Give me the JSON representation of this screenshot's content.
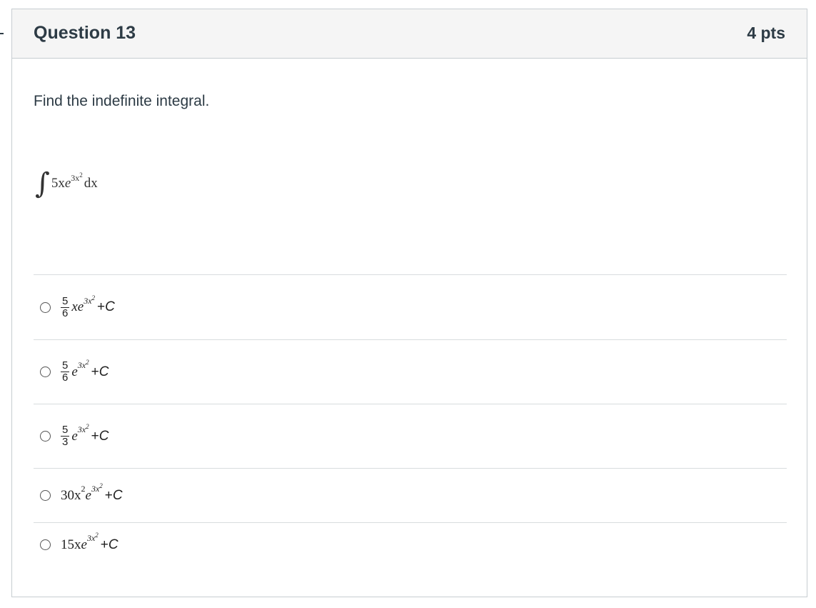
{
  "question": {
    "title": "Question 13",
    "points": "4 pts",
    "prompt": "Find the indefinite integral.",
    "integral": {
      "sign": "∫",
      "coefficient": "5x",
      "base": "e",
      "exponent": "3x",
      "exponent_power": "2",
      "differential": "dx"
    }
  },
  "answers": [
    {
      "frac_num": "5",
      "frac_den": "6",
      "lead": "",
      "term": "xe",
      "exponent": "3x",
      "exponent_power": "2",
      "plus": "+",
      "constant": "C"
    },
    {
      "frac_num": "5",
      "frac_den": "6",
      "lead": "",
      "term": "e",
      "exponent": "3x",
      "exponent_power": "2",
      "plus": "+",
      "constant": "C"
    },
    {
      "frac_num": "5",
      "frac_den": "3",
      "lead": "",
      "term": "e",
      "exponent": "3x",
      "exponent_power": "2",
      "plus": "+",
      "constant": "C"
    },
    {
      "frac_num": "",
      "frac_den": "",
      "lead": "30x",
      "lead_power": "2",
      "term": "e",
      "exponent": "3x",
      "exponent_power": "2",
      "plus": "+",
      "constant": "C"
    },
    {
      "frac_num": "",
      "frac_den": "",
      "lead": "15x",
      "term": "e",
      "exponent": "3x",
      "exponent_power": "2",
      "plus": "+",
      "constant": "C"
    }
  ]
}
